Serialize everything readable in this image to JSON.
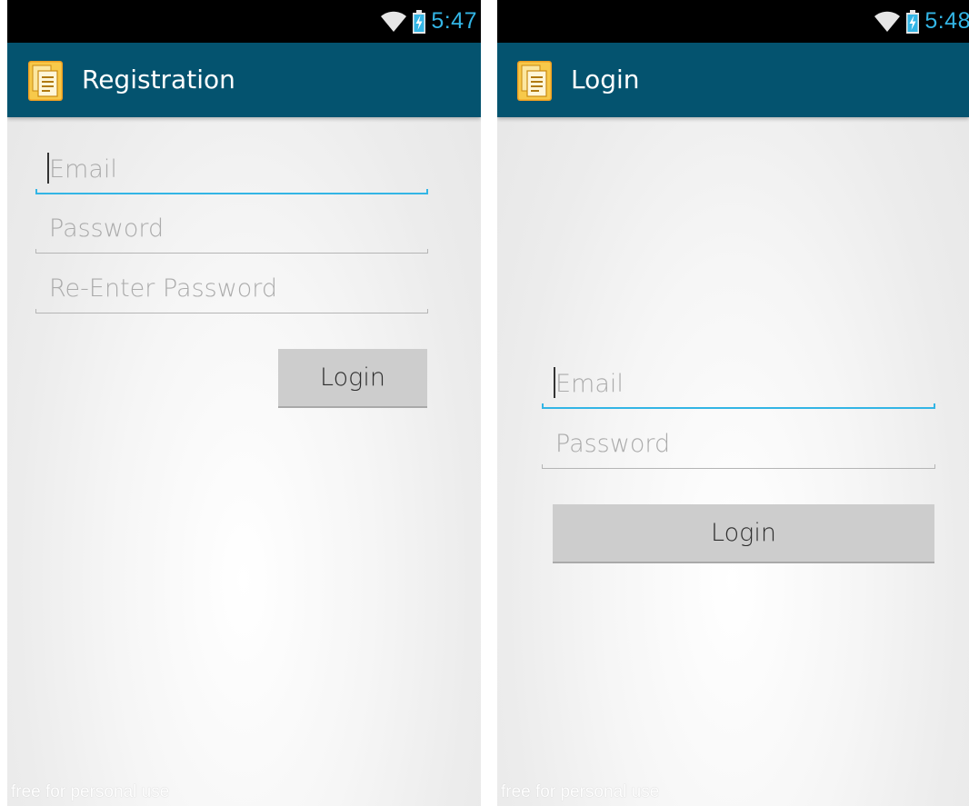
{
  "colors": {
    "action_bar": "#04536f",
    "accent": "#33b5e5",
    "status_bar": "#000000",
    "button": "#cdcdcd"
  },
  "registration": {
    "status_bar": {
      "time": "5:47",
      "icons": [
        "wifi-icon",
        "battery-charging-icon"
      ]
    },
    "action_bar": {
      "icon": "app-document-icon",
      "title": "Registration"
    },
    "form": {
      "email_placeholder": "Email",
      "password_placeholder": "Password",
      "reenter_password_placeholder": "Re-Enter Password",
      "submit_label": "Login"
    },
    "watermark": "free for personal use"
  },
  "login": {
    "status_bar": {
      "time": "5:48",
      "icons": [
        "wifi-icon",
        "battery-charging-icon"
      ]
    },
    "action_bar": {
      "icon": "app-document-icon",
      "title": "Login"
    },
    "form": {
      "email_placeholder": "Email",
      "password_placeholder": "Password",
      "submit_label": "Login"
    },
    "watermark": "free for personal use"
  }
}
